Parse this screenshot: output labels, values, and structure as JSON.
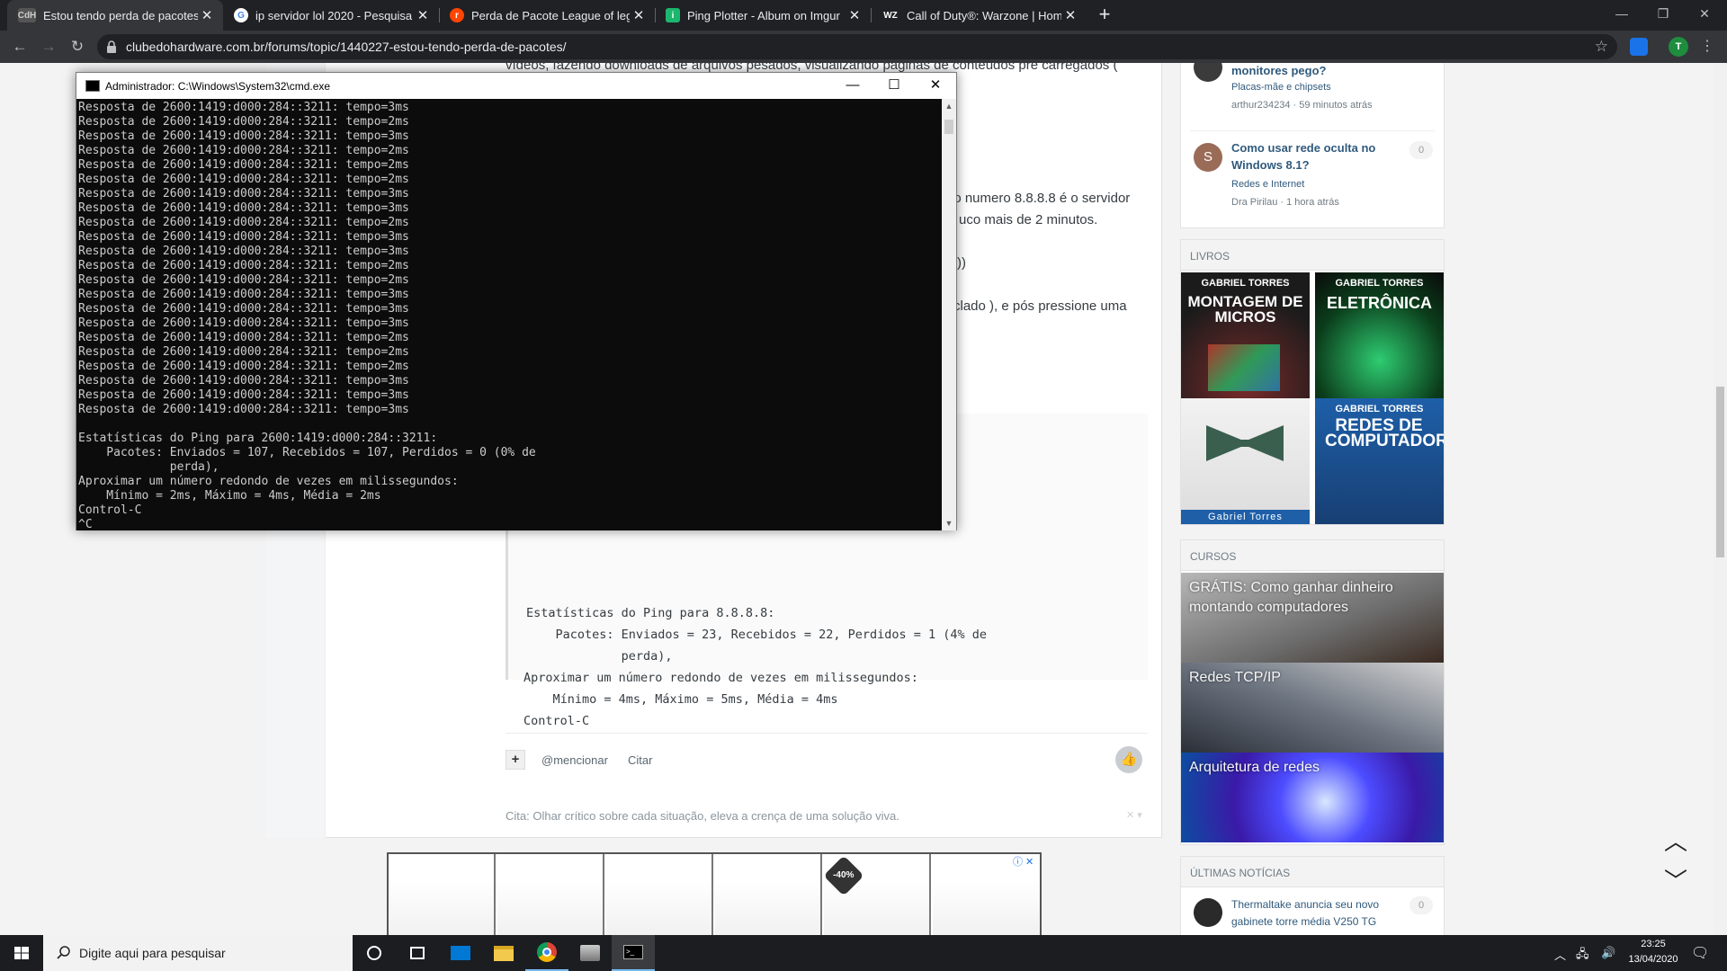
{
  "browser": {
    "tabs": [
      {
        "title": "Estou tendo perda de pacotes? -",
        "favicon": "CdH",
        "active": true
      },
      {
        "title": "ip servidor lol 2020 - Pesquisa Go",
        "favicon": "G"
      },
      {
        "title": "Perda de Pacote League of legen",
        "favicon": "r"
      },
      {
        "title": "Ping Plotter - Album on Imgur",
        "favicon": "i"
      },
      {
        "title": "Call of Duty®: Warzone | Home",
        "favicon": "WZ"
      }
    ],
    "url": "clubedohardware.com.br/forums/topic/1440227-estou-tendo-perda-de-pacotes/",
    "profile_initial": "T"
  },
  "post": {
    "lines": [
      "vídeos, fazendo downloads de arquivos pesados, visualizando páginas de conteúdos pré carregados (",
      ", o numero 8.8.8.8 é o servidor",
      "uco mais de 2 minutos.",
      "))",
      "clado ), e pós pressione uma"
    ],
    "code": [
      "Estatísticas do Ping para 8.8.8.8:",
      "    Pacotes: Enviados = 23, Recebidos = 22, Perdidos = 1 (4% de",
      "             perda),",
      "Aproximar um número redondo de vezes em milissegundos:",
      "    Mínimo = 4ms, Máximo = 5ms, Média = 4ms",
      "Control-C"
    ],
    "plus_label": "+",
    "mention_label": "@mencionar",
    "quote_label": "Citar",
    "signature": "Cita: Olhar crítico sobre cada situação, eleva a crença de uma solução viva."
  },
  "ad": {
    "badge": "-40%"
  },
  "sidebar": {
    "activity": [
      {
        "title": "monitores pego?",
        "category": "Placas-mãe e chipsets",
        "meta": "arthur234234 · 59 minutos atrás"
      },
      {
        "title": "Como usar rede oculta no Windows 8.1?",
        "category": "Redes e Internet",
        "meta": "Dra Pirilau · 1 hora atrás",
        "avatar": "S",
        "count": "0"
      }
    ],
    "books_heading": "Livros",
    "books": [
      {
        "author": "GABRIEL TORRES",
        "title": "MONTAGEM DE MICROS"
      },
      {
        "author": "GABRIEL TORRES",
        "title": "ELETRÔNICA"
      },
      {
        "author": "Gabriel Torres",
        "title": ""
      },
      {
        "author": "GABRIEL TORRES",
        "title": "REDES DE COMPUTADORES"
      }
    ],
    "courses_heading": "Cursos",
    "courses": [
      "GRÁTIS: Como ganhar dinheiro montando computadores",
      "Redes TCP/IP",
      "Arquitetura de redes"
    ],
    "news_heading": "Últimas notícias",
    "news": {
      "title": "Thermaltake anuncia seu novo gabinete torre média V250 TG",
      "count": "0"
    }
  },
  "cmd": {
    "title": "Administrador: C:\\Windows\\System32\\cmd.exe",
    "reply_lines": [
      "Resposta de 2600:1419:d000:284::3211: tempo=3ms",
      "Resposta de 2600:1419:d000:284::3211: tempo=2ms",
      "Resposta de 2600:1419:d000:284::3211: tempo=3ms",
      "Resposta de 2600:1419:d000:284::3211: tempo=2ms",
      "Resposta de 2600:1419:d000:284::3211: tempo=2ms",
      "Resposta de 2600:1419:d000:284::3211: tempo=2ms",
      "Resposta de 2600:1419:d000:284::3211: tempo=3ms",
      "Resposta de 2600:1419:d000:284::3211: tempo=3ms",
      "Resposta de 2600:1419:d000:284::3211: tempo=2ms",
      "Resposta de 2600:1419:d000:284::3211: tempo=3ms",
      "Resposta de 2600:1419:d000:284::3211: tempo=3ms",
      "Resposta de 2600:1419:d000:284::3211: tempo=2ms",
      "Resposta de 2600:1419:d000:284::3211: tempo=2ms",
      "Resposta de 2600:1419:d000:284::3211: tempo=3ms",
      "Resposta de 2600:1419:d000:284::3211: tempo=3ms",
      "Resposta de 2600:1419:d000:284::3211: tempo=3ms",
      "Resposta de 2600:1419:d000:284::3211: tempo=2ms",
      "Resposta de 2600:1419:d000:284::3211: tempo=2ms",
      "Resposta de 2600:1419:d000:284::3211: tempo=2ms",
      "Resposta de 2600:1419:d000:284::3211: tempo=3ms",
      "Resposta de 2600:1419:d000:284::3211: tempo=3ms",
      "Resposta de 2600:1419:d000:284::3211: tempo=3ms"
    ],
    "stats_lines": [
      "",
      "Estatísticas do Ping para 2600:1419:d000:284::3211:",
      "    Pacotes: Enviados = 107, Recebidos = 107, Perdidos = 0 (0% de",
      "             perda),",
      "Aproximar um número redondo de vezes em milissegundos:",
      "    Mínimo = 2ms, Máximo = 4ms, Média = 2ms",
      "Control-C",
      "^C"
    ]
  },
  "taskbar": {
    "search_placeholder": "Digite aqui para pesquisar",
    "time": "23:25",
    "date": "13/04/2020"
  },
  "colors": {
    "tab_bar": "#202124",
    "cmd_bg": "#0c0c0c",
    "link": "#305a7d"
  }
}
